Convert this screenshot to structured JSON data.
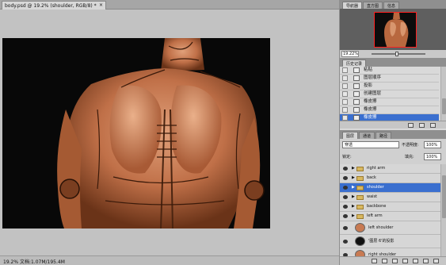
{
  "document": {
    "tab_title": "body.psd @ 19.2% (shoulder, RGB/8) *",
    "close_glyph": "×",
    "status_text": "19.2%    文档:1.07M/195.4M"
  },
  "navigator": {
    "tabs": [
      "导航器",
      "直方图",
      "信息"
    ],
    "zoom": "19.22%"
  },
  "history": {
    "tab": "历史记录",
    "items": [
      {
        "label": "粘贴",
        "active": false
      },
      {
        "label": "图层顺序",
        "active": false
      },
      {
        "label": "投影",
        "active": false
      },
      {
        "label": "创建图层",
        "active": false
      },
      {
        "label": "橡皮擦",
        "active": false
      },
      {
        "label": "橡皮擦",
        "active": false
      },
      {
        "label": "橡皮擦",
        "active": true
      }
    ]
  },
  "layers": {
    "tabs": [
      "图层",
      "通道",
      "路径"
    ],
    "blend_mode": "穿透",
    "opacity_label": "不透明度:",
    "opacity": "100%",
    "lock_label": "锁定:",
    "fill_label": "填充:",
    "fill": "100%",
    "items": [
      {
        "name": "right arm",
        "type": "group",
        "active": false
      },
      {
        "name": "back",
        "type": "group",
        "active": false
      },
      {
        "name": "shoulder",
        "type": "group",
        "active": true
      },
      {
        "name": "waist",
        "type": "group",
        "active": false
      },
      {
        "name": "backbone",
        "type": "group",
        "active": false
      },
      {
        "name": "left arm",
        "type": "group",
        "active": false
      },
      {
        "name": "left shoulder",
        "type": "layer",
        "active": false
      },
      {
        "name": "'图层 6'的投影",
        "type": "layer",
        "active": false
      },
      {
        "name": "right shoulder",
        "type": "layer",
        "active": false
      }
    ]
  },
  "colors": {
    "selection": "#3a6fcf",
    "skin": "#c87a52",
    "nav_frame": "#ff2020"
  }
}
